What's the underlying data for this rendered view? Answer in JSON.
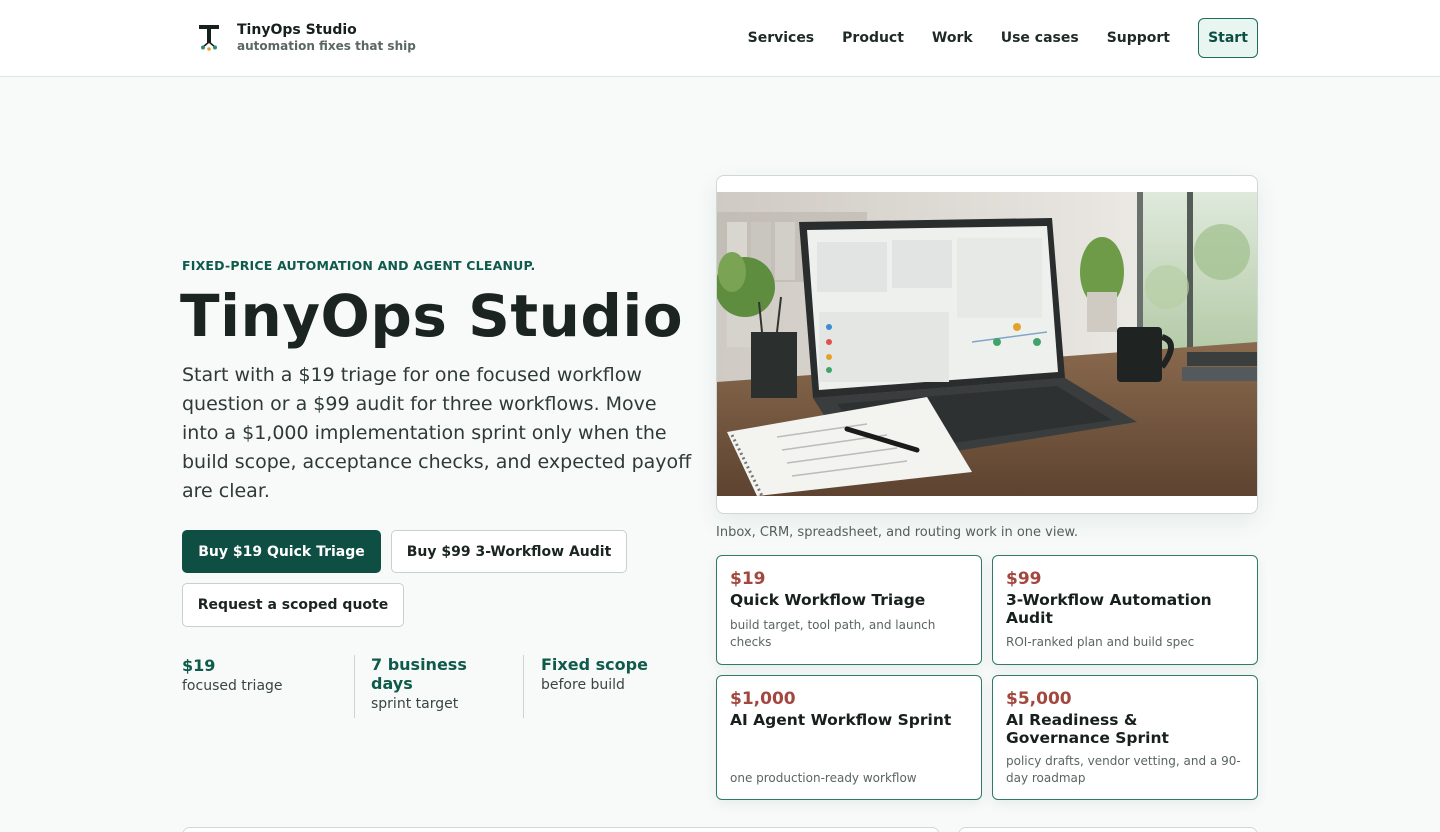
{
  "brand": {
    "name": "TinyOps Studio",
    "tagline": "automation fixes that ship"
  },
  "nav": {
    "links": [
      "Services",
      "Product",
      "Work",
      "Use cases",
      "Support"
    ],
    "start_label": "Start"
  },
  "hero": {
    "eyebrow": "FIXED-PRICE AUTOMATION AND AGENT CLEANUP.",
    "title": "TinyOps Studio",
    "description": "Start with a $19 triage for one focused workflow question or a $99 audit for three workflows. Move into a $1,000 implementation sprint only when the build scope, acceptance checks, and expected payoff are clear.",
    "buttons": {
      "primary": "Buy $19 Quick Triage",
      "secondary": "Buy $99 3-Workflow Audit",
      "quote": "Request a scoped quote"
    },
    "stats": [
      {
        "value": "$19",
        "label": "focused triage"
      },
      {
        "value": "7 business days",
        "label": "sprint target"
      },
      {
        "value": "Fixed scope",
        "label": "before build"
      }
    ]
  },
  "media": {
    "caption": "Inbox, CRM, spreadsheet, and routing work in one view."
  },
  "offers": [
    {
      "price": "$19",
      "name": "Quick Workflow Triage",
      "desc": "build target, tool path, and launch checks"
    },
    {
      "price": "$99",
      "name": "3-Workflow Automation Audit",
      "desc": "ROI-ranked plan and build spec"
    },
    {
      "price": "$1,000",
      "name": "AI Agent Workflow Sprint",
      "desc": "one production-ready workflow"
    },
    {
      "price": "$5,000",
      "name": "AI Readiness & Governance Sprint",
      "desc": "policy drafts, vendor vetting, and a 90-day roadmap"
    }
  ],
  "colors": {
    "accent": "#0f4e43",
    "price": "#a2483e",
    "background": "#f7faf9"
  }
}
